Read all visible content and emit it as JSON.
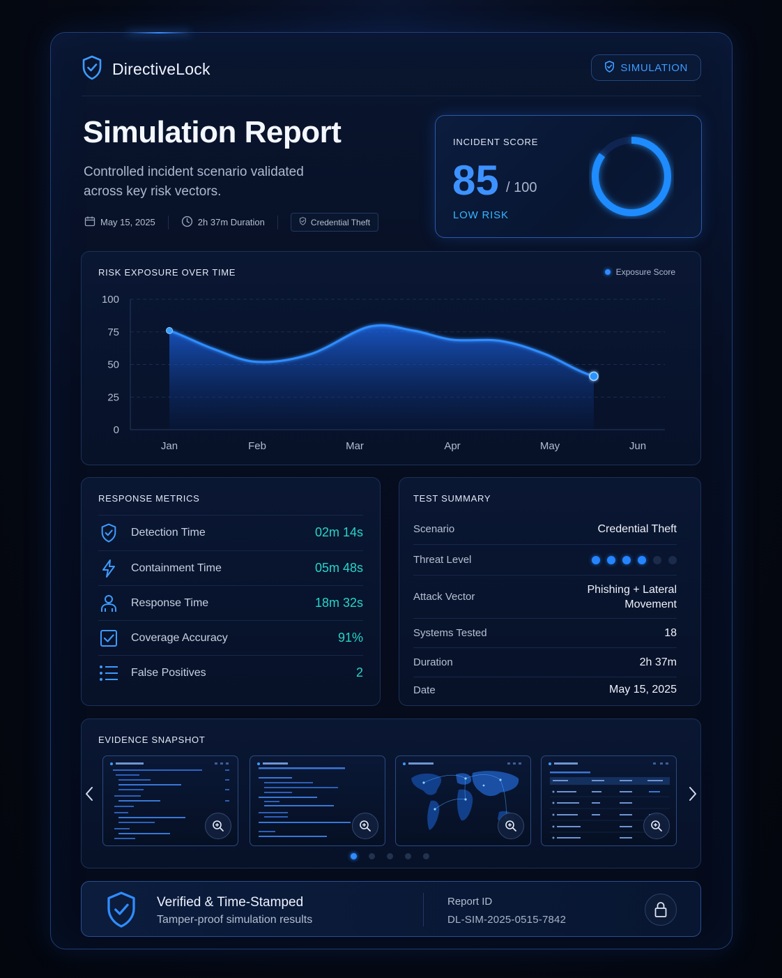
{
  "brand": {
    "name": "DirectiveLock"
  },
  "badge": {
    "label": "SIMULATION"
  },
  "header": {
    "title": "Simulation Report",
    "subtitle": "Controlled incident scenario validated across key risk vectors.",
    "date": "May 15, 2025",
    "duration": "2h 37m Duration",
    "tag": "Credential Theft"
  },
  "incident": {
    "label": "INCIDENT SCORE",
    "score": "85",
    "max": "/ 100",
    "risk": "LOW RISK",
    "score_value": 85,
    "score_max": 100
  },
  "colors": {
    "accent": "#2e8cff",
    "teal": "#27d5c9",
    "background": "#050913"
  },
  "chart_data": {
    "type": "area",
    "title": "RISK EXPOSURE OVER TIME",
    "legend": "Exposure Score",
    "legend_position": "top-right",
    "categories": [
      "Jan",
      "Feb",
      "Mar",
      "Apr",
      "May",
      "Jun"
    ],
    "x": [
      0.1,
      1.0,
      2.0,
      3.0,
      4.0,
      4.9
    ],
    "series": [
      {
        "name": "Exposure Score",
        "x": [
          -0.15,
          0.1,
          0.55,
          1.0,
          1.55,
          2.15,
          2.6,
          3.0,
          3.5,
          3.95,
          4.45,
          5.05
        ],
        "values": [
          78,
          76,
          62,
          52,
          58,
          79,
          76,
          69,
          68,
          58,
          41,
          34
        ]
      }
    ],
    "ylim": [
      0,
      100
    ],
    "yticks": [
      0,
      25,
      50,
      75,
      100
    ],
    "grid": true
  },
  "response": {
    "title": "RESPONSE METRICS",
    "rows": [
      {
        "label": "Detection Time",
        "value": "02m 14s",
        "icon": "shield-check-icon"
      },
      {
        "label": "Containment Time",
        "value": "05m 48s",
        "icon": "bolt-icon"
      },
      {
        "label": "Response Time",
        "value": "18m 32s",
        "icon": "user-icon"
      },
      {
        "label": "Coverage Accuracy",
        "value": "91%",
        "icon": "checkbox-icon"
      },
      {
        "label": "False Positives",
        "value": "2",
        "icon": "list-icon"
      }
    ]
  },
  "summary": {
    "title": "TEST SUMMARY",
    "scenario_label": "Scenario",
    "scenario_value": "Credential Theft",
    "threat_label": "Threat Level",
    "threat_level": 4,
    "threat_max": 6,
    "vector_label": "Attack Vector",
    "vector_value_1": "Phishing + Lateral",
    "vector_value_2": "Movement",
    "systems_label": "Systems Tested",
    "systems_value": "18",
    "duration_label": "Duration",
    "duration_value": "2h 37m",
    "date_label": "Date",
    "date_value": "May 15, 2025"
  },
  "evidence": {
    "title": "EVIDENCE SNAPSHOT",
    "thumbs": [
      {
        "icon": "code-log-icon"
      },
      {
        "icon": "code-log-icon"
      },
      {
        "icon": "world-map-icon"
      },
      {
        "icon": "table-icon"
      }
    ],
    "page": 1,
    "pages": 5
  },
  "footer": {
    "title": "Verified & Time-Stamped",
    "subtitle": "Tamper-proof simulation results",
    "id_label": "Report ID",
    "id_value": "DL-SIM-2025-0515-7842"
  }
}
